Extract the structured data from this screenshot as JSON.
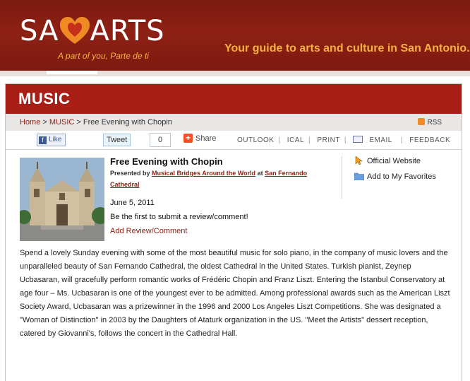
{
  "header": {
    "logo_left": "SA",
    "logo_right": "ARTS",
    "tagline": "A part of you, Parte de ti",
    "guide": "Your guide to arts and culture in San Antonio."
  },
  "section": {
    "title": "MUSIC"
  },
  "breadcrumb": {
    "home": "Home",
    "music": "MUSIC",
    "current": "Free Evening with Chopin",
    "sep": ">",
    "rss": "RSS"
  },
  "toolbar": {
    "like": "Like",
    "tweet": "Tweet",
    "tweet_count": "0",
    "share": "Share",
    "outlook": "OUTLOOK",
    "ical": "ICAL",
    "print": "PRINT",
    "email": "EMAIL",
    "feedback": "FEEDBACK"
  },
  "event": {
    "title": "Free Evening with Chopin",
    "presented_prefix": "Presented by",
    "presenter": "Musical Bridges Around the World",
    "at": "at",
    "venue": "San Fernando Cathedral",
    "date": "June 5, 2011",
    "review_prompt": "Be the first to submit a review/comment!",
    "add_review": "Add Review/Comment",
    "official_website": "Official Website",
    "add_favorites": "Add to My Favorites",
    "description": "Spend a lovely Sunday evening with some of the most beautiful music for solo piano, in the company of music lovers and the unparalleled beauty of San Fernando Cathedral, the oldest Cathedral in the United States. Turkish pianist, Zeynep Ucbasaran, will gracefully perform romantic works of Frédéric Chopin and Franz Liszt. Entering the Istanbul Conservatory at age four – Ms. Ucbasaran is one of the youngest ever to be admitted. Among professional awards such as the American Liszt Society Award, Ucbasaran was a prizewinner in the 1996 and 2000 Los Angeles Liszt Competitions. She was designated a \"Woman of Distinction\" in 2003 by the Daughters of Ataturk organization in the US. \"Meet the Artists\" dessert reception, catered by Giovanni's, follows the concert in the Cathedral Hall."
  },
  "colors": {
    "brand_red": "#a91f16",
    "header_red": "#8e2114",
    "accent_orange": "#f5b044",
    "link": "#8e2114"
  }
}
